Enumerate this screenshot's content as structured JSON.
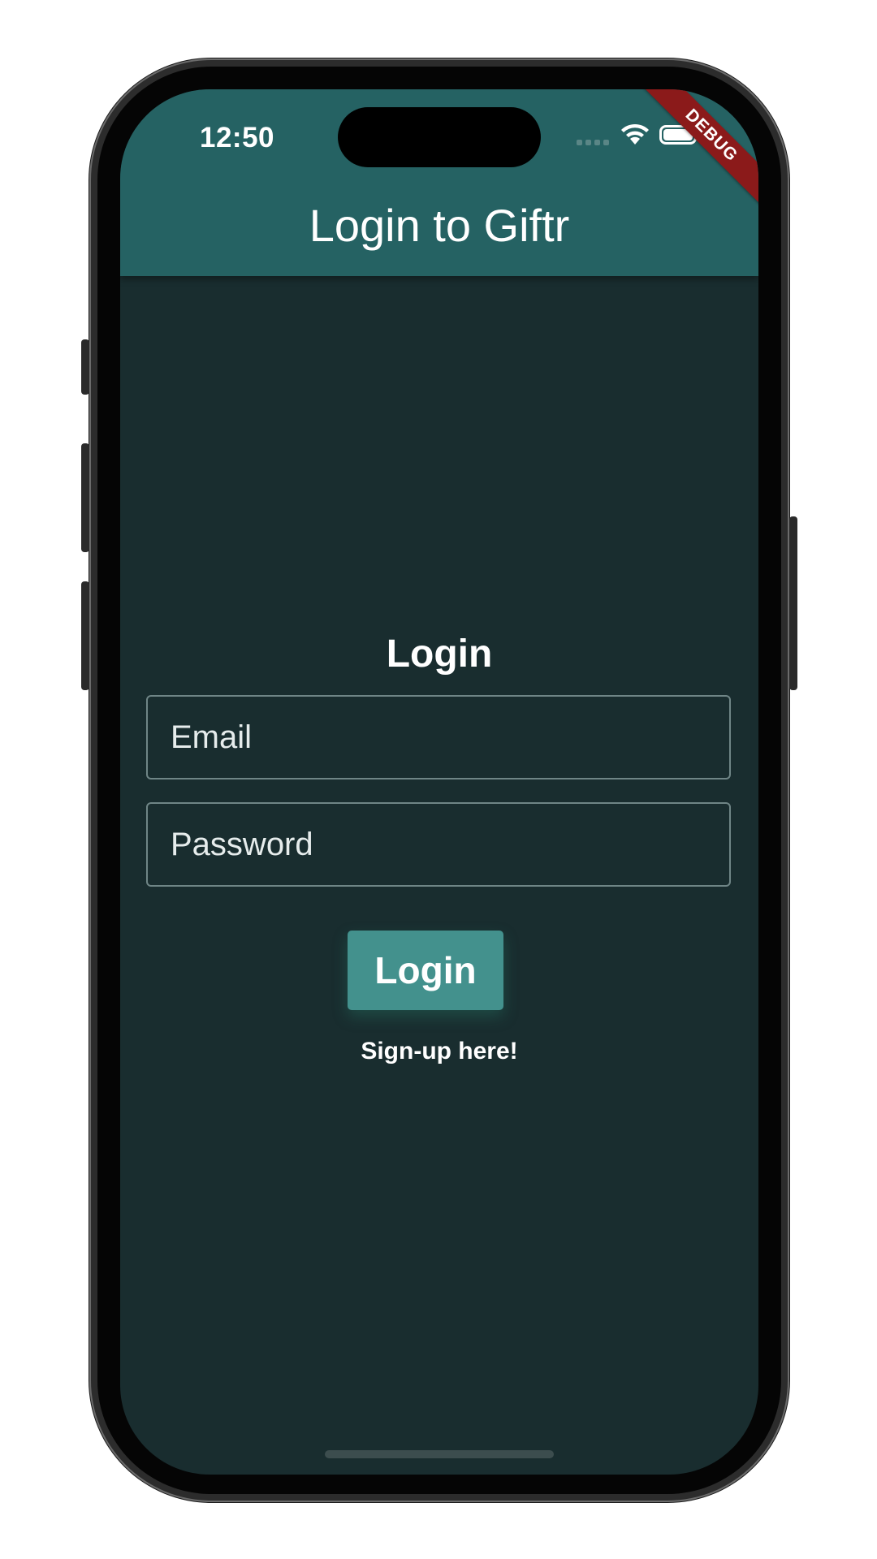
{
  "status_bar": {
    "time": "12:50",
    "wifi_icon": "wifi-icon",
    "battery_icon": "battery-icon",
    "signal_icon": "cellular-signal-icon"
  },
  "debug_banner": "DEBUG",
  "app_bar": {
    "title": "Login to Giftr"
  },
  "form": {
    "heading": "Login",
    "email_placeholder": "Email",
    "email_value": "",
    "password_placeholder": "Password",
    "password_value": "",
    "login_label": "Login",
    "signup_link": "Sign-up here!"
  },
  "colors": {
    "app_bar": "#256263",
    "background": "#192d2f",
    "button": "#43918d",
    "debug_ribbon": "#8b1a1a",
    "field_border": "#6f8586"
  }
}
